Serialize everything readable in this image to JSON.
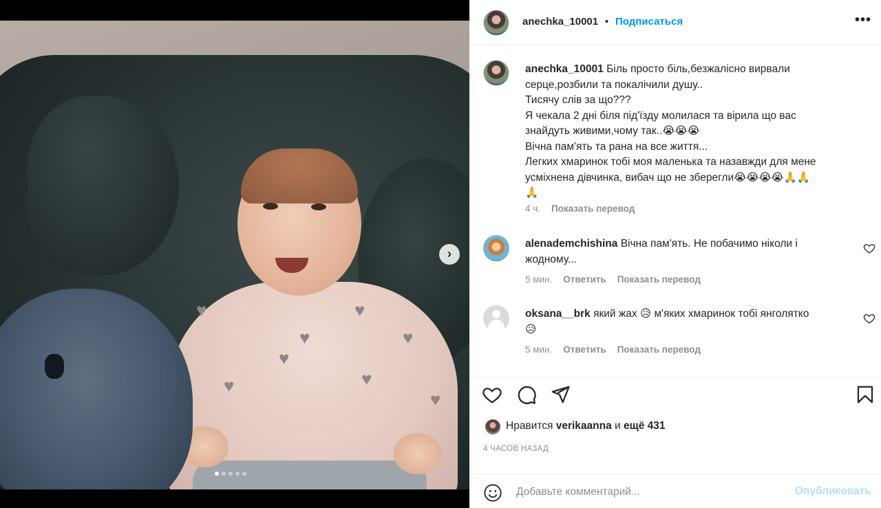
{
  "post": {
    "author": "anechka_10001",
    "separator": "•",
    "follow_label": "Подписаться",
    "more_label": "•••",
    "carousel_next": "›",
    "carousel_total": 5,
    "carousel_active": 1
  },
  "caption": {
    "author": "anechka_10001",
    "lines": [
      "Біль просто біль,безжалісно вирвали",
      "серце,розбили та покалічили душу..",
      "Тисячу слів за що???",
      "Я чекала 2 дні біля під'їзду молилася та вірила що вас",
      "знайдуть живими,чому так..😭😭😭",
      "Вічна пам'ять та рана на все життя...",
      "Легких хмаринок тобі моя маленька та назавжди для мене",
      "усміхнена дівчинка, вибач що не зберегли😭😭😭😭🙏🙏",
      "🙏"
    ],
    "time": "4 ч.",
    "translate_label": "Показать перевод"
  },
  "comments": [
    {
      "username": "alenademchishina",
      "lines": [
        "Вічна пам'ять. Не побачимо ніколи і",
        "жодному..."
      ],
      "time": "5 мин.",
      "reply_label": "Ответить",
      "translate_label": "Показать перевод"
    },
    {
      "username": "oksana__brk",
      "lines": [
        "який жах 😥 м'яких хмаринок тобі янголятко",
        "😥"
      ],
      "time": "5 мин.",
      "reply_label": "Ответить",
      "translate_label": "Показать перевод"
    }
  ],
  "likes": {
    "prefix": "Нравится",
    "user": "verikaanna",
    "middle": "и",
    "rest": "ещё 431"
  },
  "timestamp": "4 ЧАСОВ НАЗАД",
  "add_comment": {
    "placeholder": "Добавьте комментарий...",
    "publish_label": "Опубликовать"
  },
  "colors": {
    "accent": "#0095f6",
    "publish_disabled": "#b2dffc",
    "muted": "#8e8e8e",
    "text": "#262626"
  }
}
